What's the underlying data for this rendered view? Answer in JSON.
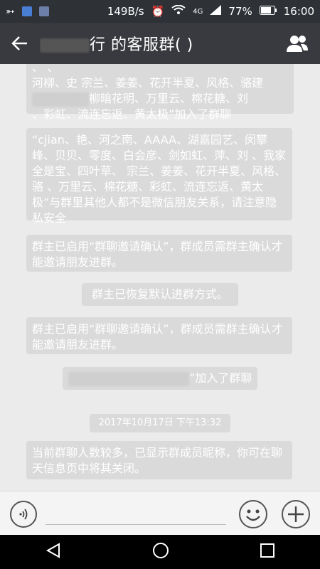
{
  "status": {
    "speed": "149B/s",
    "network": "4G",
    "battery": "77%",
    "time": "16:00"
  },
  "header": {
    "title": "行        的客服群(   )"
  },
  "messages": {
    "m1": "“cjian、艳、河之南、AAAA、湖嘉园艺、闵攀峰、贝贝、零度、白会彦、剑如虹、萍、刘    、我家全是宝、四叶草、  宗兰、姜姜、花开半夏、风格、骆      、万里云、棉花糖、彩虹、流连忘返、黄太极”与群里其他人都不是微信朋友关系，请注意隐私安全",
    "m2": "群主已启用“群聊邀请确认”，群成员需群主确认才能邀请朋友进群。",
    "m3": "群主已恢复默认进群方式。",
    "m4": "群主已启用“群聊邀请确认”，群成员需群主确认才能邀请朋友进群。",
    "m5_suffix": "”加入了群聊",
    "date": "2017年10月17日 下午13:32",
    "m6": "当前群聊人数较多，已显示群成员昵称，你可在聊天信息页中将其关闭。"
  },
  "top_partial": {
    "line1": "    、     、           ",
    "line2": "河柳、史 宗兰、姜姜、花开半夏、风格、骆建",
    "line3": "柳暗花明、万里云、棉花糖、刘",
    "line4": "   、彩虹、流连忘返、黄太极”加入了群聊"
  },
  "icons": {
    "back": "back-arrow-icon",
    "group": "group-members-icon",
    "voice": "voice-icon",
    "emoji": "emoji-icon",
    "plus": "plus-icon"
  }
}
